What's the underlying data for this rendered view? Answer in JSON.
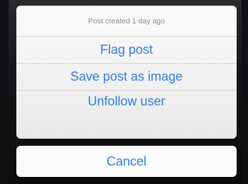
{
  "action_sheet": {
    "header": "Post created 1 day ago",
    "items": [
      {
        "label": "Flag post"
      },
      {
        "label": "Save post as image"
      },
      {
        "label": "Unfollow user"
      }
    ]
  },
  "cancel": {
    "label": "Cancel"
  },
  "colors": {
    "action_blue": "#2f7fe0",
    "header_gray": "#8a8a8a",
    "sheet_bg": "#f1f1f1",
    "backdrop": "#0e0e10"
  }
}
